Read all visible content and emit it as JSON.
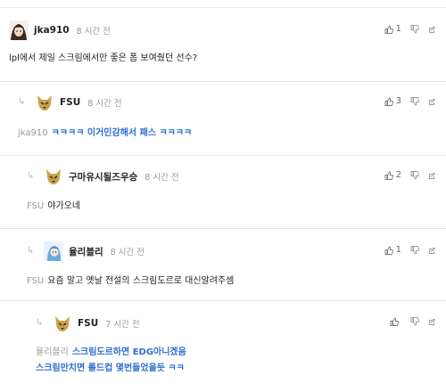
{
  "comments": [
    {
      "user": "jka910",
      "time": "8 시간 전",
      "mention": "",
      "text": "lpl에서 제일 스크림에서만 좋은 폼 보여줬던 선수?",
      "likes": "1"
    },
    {
      "user": "FSU",
      "time": "8 시간 전",
      "mention": "jka910",
      "text": "ㅋㅋㅋㅋ 이거민감해서 패스 ㅋㅋㅋㅋ",
      "likes": "3"
    },
    {
      "user": "구마유시될즈우승",
      "time": "8 시간 전",
      "mention": "FSU",
      "text": "야가오네",
      "likes": "2"
    },
    {
      "user": "율리블리",
      "time": "8 시간 전",
      "mention": "FSU",
      "text": "요즘 말고 옛날 전설의 스크림도르로 대신알려주셈",
      "likes": "1"
    },
    {
      "user": "FSU",
      "time": "7 시간 전",
      "mention": "율리블리",
      "text_line1": "스크림도르하면 EDG아니겠음",
      "text_line2": "스크림만치면 롤드컵 몇번들었을듯 ㅋㅋ",
      "likes": ""
    }
  ],
  "icons": {
    "like": "thumbs-up-icon",
    "dislike": "thumbs-down-icon",
    "share": "share-icon",
    "reply": "reply-arrow-icon"
  },
  "colors": {
    "reply_text": "#2f6fd0",
    "meta": "#9a9a9a",
    "divider": "#e7e7e7"
  }
}
